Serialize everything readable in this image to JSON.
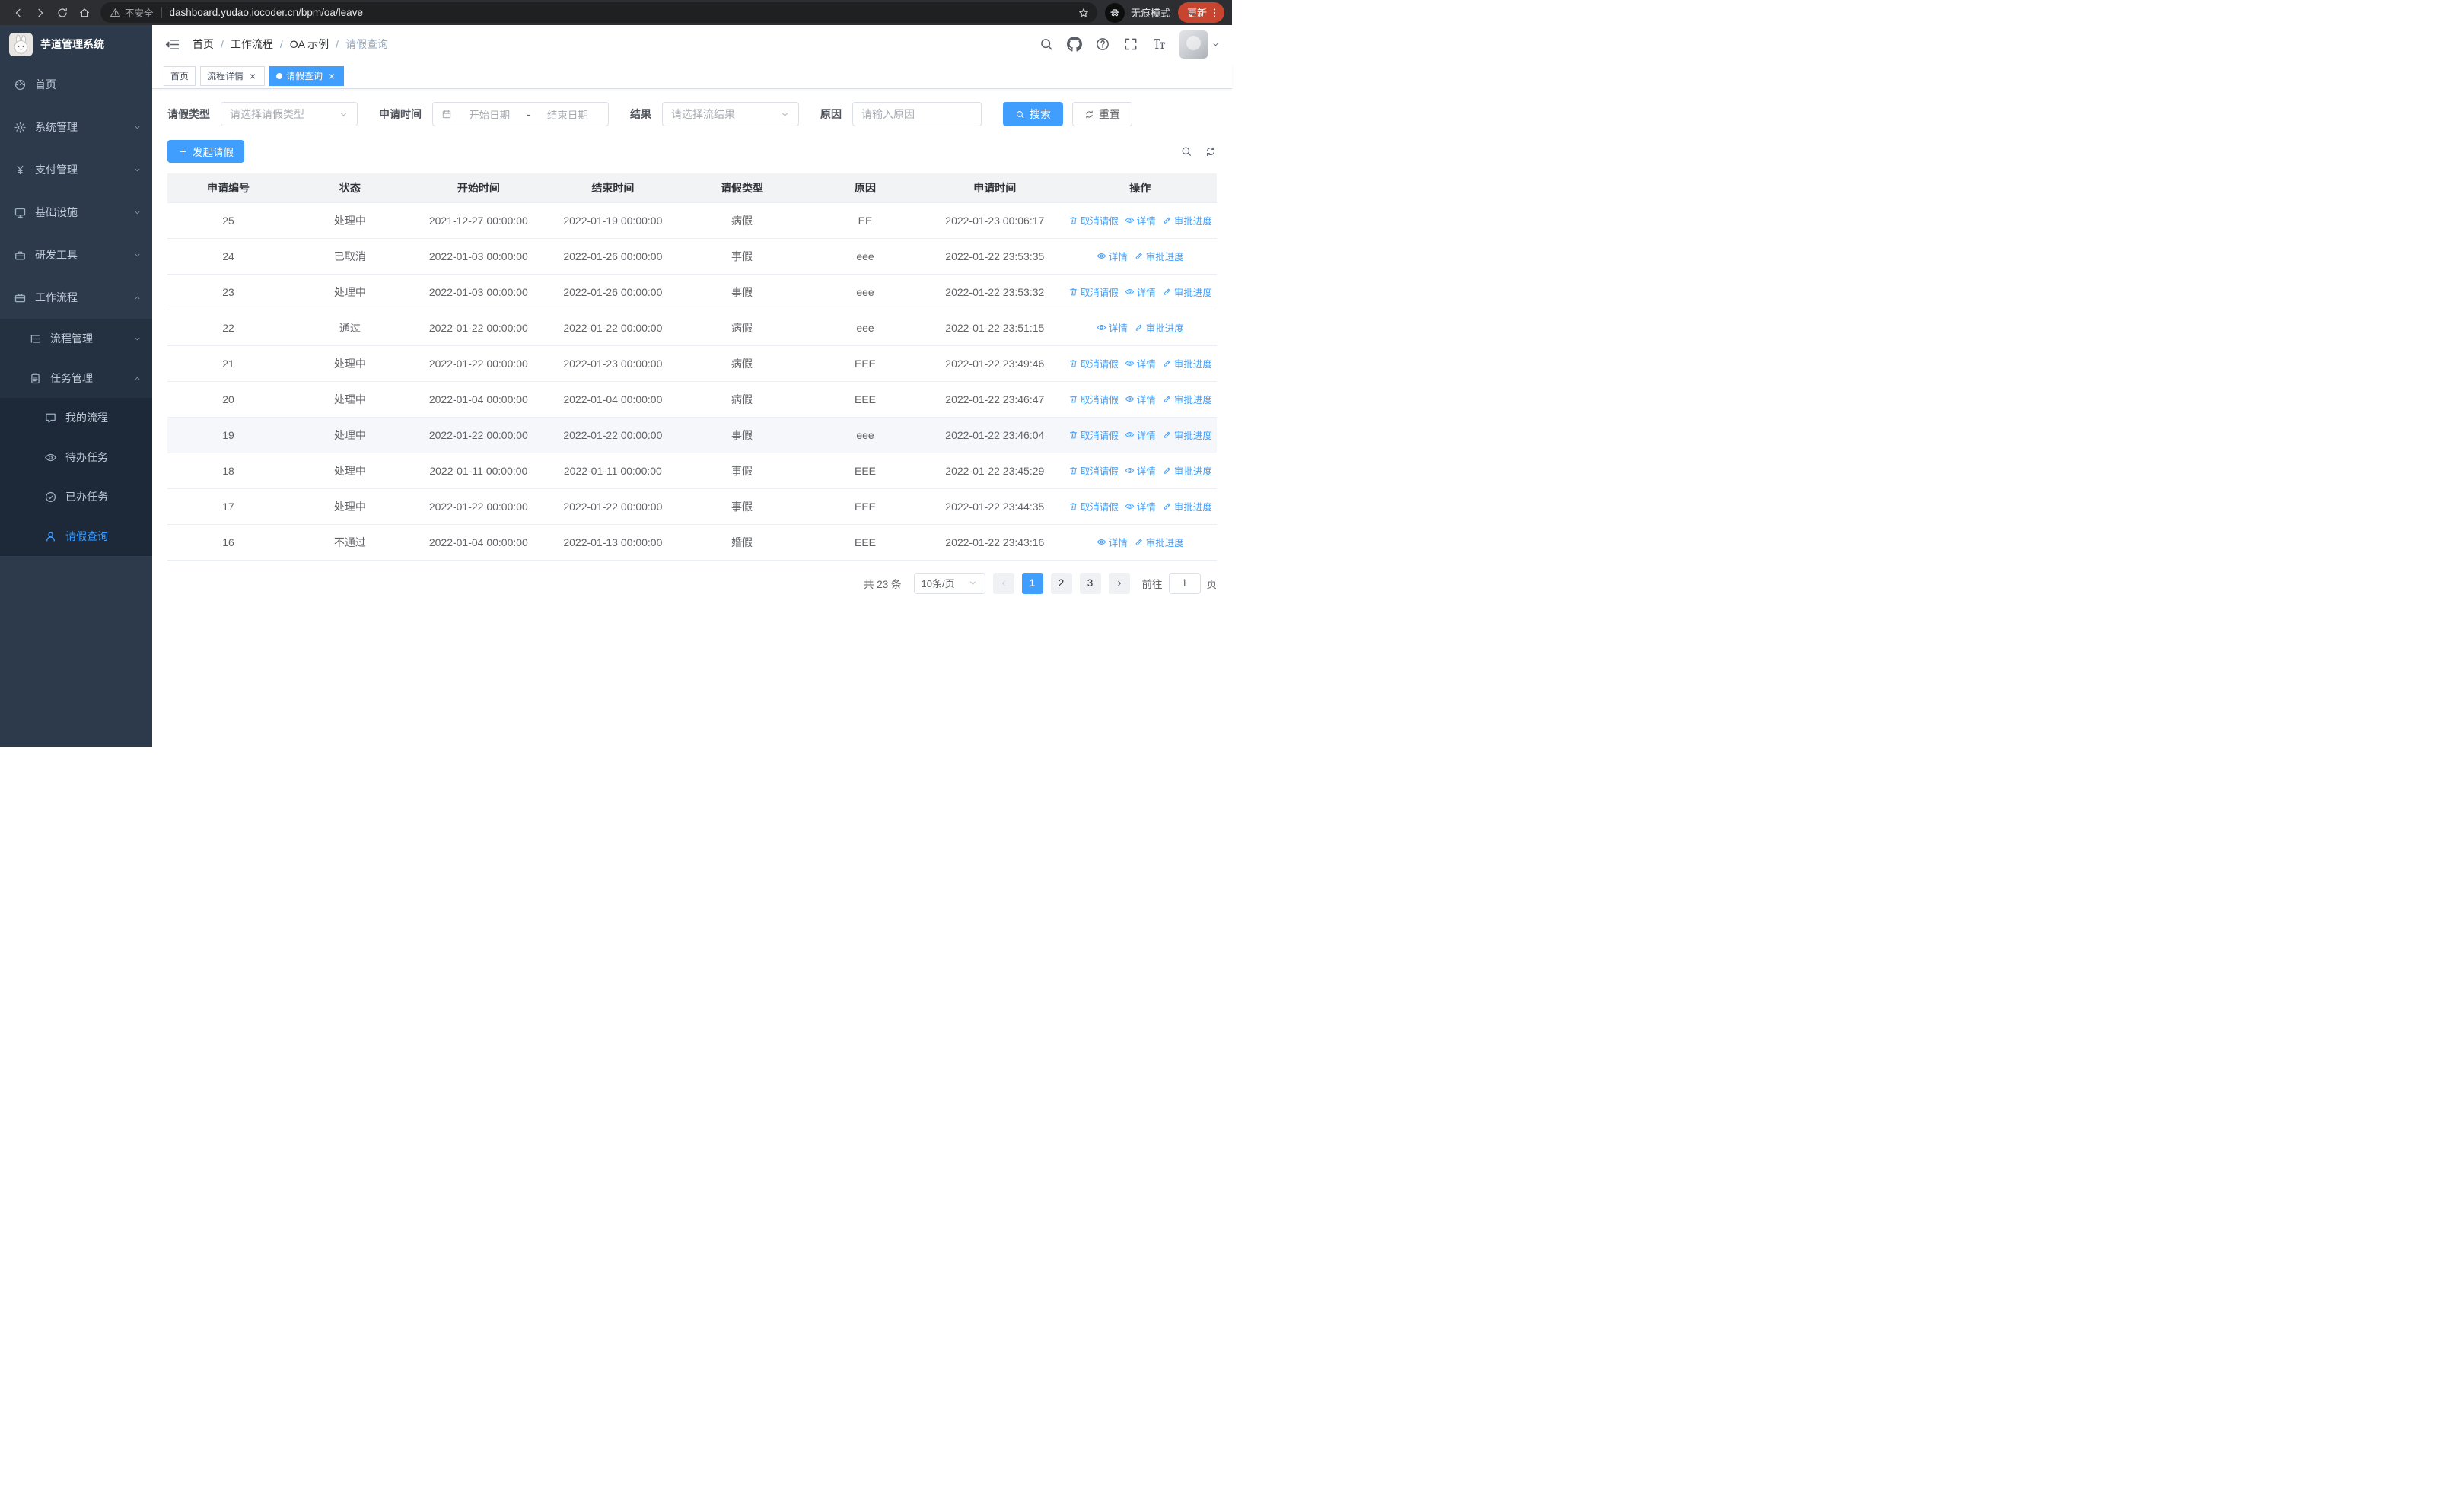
{
  "browser": {
    "security_warning": "不安全",
    "url": "dashboard.yudao.iocoder.cn/bpm/oa/leave",
    "incognito_label": "无痕模式",
    "update_label": "更新"
  },
  "sidebar": {
    "logo_title": "芋道管理系统",
    "menu": [
      {
        "key": "home",
        "label": "首页",
        "icon": "dashboard",
        "level": 0
      },
      {
        "key": "system",
        "label": "系统管理",
        "icon": "gear",
        "level": 0,
        "chevron": "down"
      },
      {
        "key": "payment",
        "label": "支付管理",
        "icon": "yen",
        "level": 0,
        "chevron": "down"
      },
      {
        "key": "infra",
        "label": "基础设施",
        "icon": "monitor",
        "level": 0,
        "chevron": "down"
      },
      {
        "key": "devtools",
        "label": "研发工具",
        "icon": "toolbox",
        "level": 0,
        "chevron": "down"
      },
      {
        "key": "workflow",
        "label": "工作流程",
        "icon": "briefcase",
        "level": 0,
        "chevron": "up"
      },
      {
        "key": "process-mgmt",
        "label": "流程管理",
        "icon": "tree",
        "level": 1,
        "chevron": "down"
      },
      {
        "key": "task-mgmt",
        "label": "任务管理",
        "icon": "clipboard",
        "level": 1,
        "chevron": "up"
      },
      {
        "key": "my-process",
        "label": "我的流程",
        "icon": "chat",
        "level": 2
      },
      {
        "key": "todo-task",
        "label": "待办任务",
        "icon": "eye",
        "level": 2
      },
      {
        "key": "done-task",
        "label": "已办任务",
        "icon": "check-circle",
        "level": 2
      },
      {
        "key": "leave-query",
        "label": "请假查询",
        "icon": "user",
        "level": 2,
        "active": true
      }
    ]
  },
  "header": {
    "breadcrumb": [
      "首页",
      "工作流程",
      "OA 示例",
      "请假查询"
    ]
  },
  "tabs": [
    {
      "key": "home",
      "label": "首页",
      "closable": false,
      "active": false
    },
    {
      "key": "process-detail",
      "label": "流程详情",
      "closable": true,
      "active": false
    },
    {
      "key": "leave-query",
      "label": "请假查询",
      "closable": true,
      "active": true
    }
  ],
  "filters": {
    "leave_type_label": "请假类型",
    "leave_type_placeholder": "请选择请假类型",
    "apply_time_label": "申请时间",
    "start_date_placeholder": "开始日期",
    "date_separator": "-",
    "end_date_placeholder": "结束日期",
    "result_label": "结果",
    "result_placeholder": "请选择流结果",
    "reason_label": "原因",
    "reason_placeholder": "请输入原因",
    "search_button": "搜索",
    "reset_button": "重置"
  },
  "toolbar": {
    "create_button": "发起请假"
  },
  "table": {
    "columns": [
      "申请编号",
      "状态",
      "开始时间",
      "结束时间",
      "请假类型",
      "原因",
      "申请时间",
      "操作"
    ],
    "action_defs": {
      "cancel": {
        "label": "取消请假",
        "icon": "trash"
      },
      "detail": {
        "label": "详情",
        "icon": "eye"
      },
      "progress": {
        "label": "审批进度",
        "icon": "edit"
      }
    },
    "rows": [
      {
        "id": "25",
        "status": "处理中",
        "start": "2021-12-27 00:00:00",
        "end": "2022-01-19 00:00:00",
        "type": "病假",
        "reason": "EE",
        "apply_time": "2022-01-23 00:06:17",
        "actions": [
          "cancel",
          "detail",
          "progress"
        ]
      },
      {
        "id": "24",
        "status": "已取消",
        "start": "2022-01-03 00:00:00",
        "end": "2022-01-26 00:00:00",
        "type": "事假",
        "reason": "eee",
        "apply_time": "2022-01-22 23:53:35",
        "actions": [
          "detail",
          "progress"
        ]
      },
      {
        "id": "23",
        "status": "处理中",
        "start": "2022-01-03 00:00:00",
        "end": "2022-01-26 00:00:00",
        "type": "事假",
        "reason": "eee",
        "apply_time": "2022-01-22 23:53:32",
        "actions": [
          "cancel",
          "detail",
          "progress"
        ]
      },
      {
        "id": "22",
        "status": "通过",
        "start": "2022-01-22 00:00:00",
        "end": "2022-01-22 00:00:00",
        "type": "病假",
        "reason": "eee",
        "apply_time": "2022-01-22 23:51:15",
        "actions": [
          "detail",
          "progress"
        ]
      },
      {
        "id": "21",
        "status": "处理中",
        "start": "2022-01-22 00:00:00",
        "end": "2022-01-23 00:00:00",
        "type": "病假",
        "reason": "EEE",
        "apply_time": "2022-01-22 23:49:46",
        "actions": [
          "cancel",
          "detail",
          "progress"
        ]
      },
      {
        "id": "20",
        "status": "处理中",
        "start": "2022-01-04 00:00:00",
        "end": "2022-01-04 00:00:00",
        "type": "病假",
        "reason": "EEE",
        "apply_time": "2022-01-22 23:46:47",
        "actions": [
          "cancel",
          "detail",
          "progress"
        ]
      },
      {
        "id": "19",
        "status": "处理中",
        "start": "2022-01-22 00:00:00",
        "end": "2022-01-22 00:00:00",
        "type": "事假",
        "reason": "eee",
        "apply_time": "2022-01-22 23:46:04",
        "actions": [
          "cancel",
          "detail",
          "progress"
        ],
        "highlight": true
      },
      {
        "id": "18",
        "status": "处理中",
        "start": "2022-01-11 00:00:00",
        "end": "2022-01-11 00:00:00",
        "type": "事假",
        "reason": "EEE",
        "apply_time": "2022-01-22 23:45:29",
        "actions": [
          "cancel",
          "detail",
          "progress"
        ]
      },
      {
        "id": "17",
        "status": "处理中",
        "start": "2022-01-22 00:00:00",
        "end": "2022-01-22 00:00:00",
        "type": "事假",
        "reason": "EEE",
        "apply_time": "2022-01-22 23:44:35",
        "actions": [
          "cancel",
          "detail",
          "progress"
        ]
      },
      {
        "id": "16",
        "status": "不通过",
        "start": "2022-01-04 00:00:00",
        "end": "2022-01-13 00:00:00",
        "type": "婚假",
        "reason": "EEE",
        "apply_time": "2022-01-22 23:43:16",
        "actions": [
          "detail",
          "progress"
        ]
      }
    ]
  },
  "pagination": {
    "total_text": "共 23 条",
    "page_size_label": "10条/页",
    "pages": [
      "1",
      "2",
      "3"
    ],
    "current_page": "1",
    "goto_label": "前往",
    "goto_value": "1",
    "goto_suffix": "页"
  },
  "colors": {
    "primary": "#409eff",
    "sidebar_bg": "#2d3a4b",
    "sidebar_active": "#409eff",
    "update_chip": "#c7452f"
  }
}
